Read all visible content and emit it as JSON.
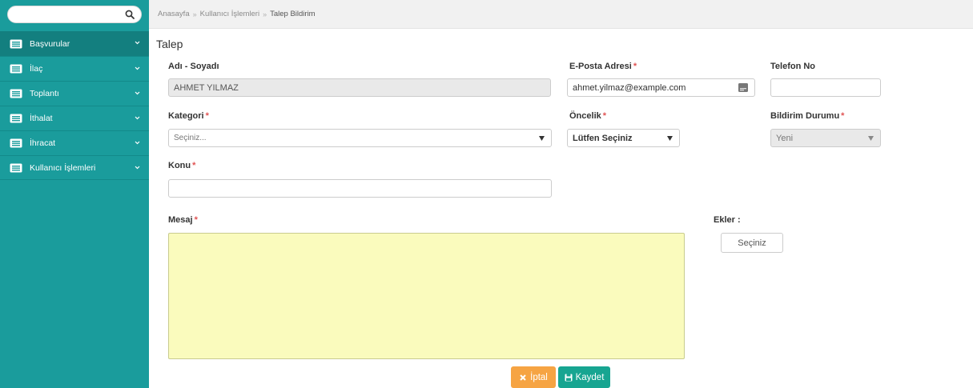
{
  "sidebar": {
    "search_placeholder": "",
    "items": [
      {
        "label": "Başvurular",
        "icon": "list-icon",
        "active": true
      },
      {
        "label": "İlaç",
        "icon": "list-icon"
      },
      {
        "label": "Toplantı",
        "icon": "list-icon"
      },
      {
        "label": "İthalat",
        "icon": "list-icon"
      },
      {
        "label": "İhracat",
        "icon": "list-icon"
      },
      {
        "label": "Kullanıcı İşlemleri",
        "icon": "list-icon"
      }
    ]
  },
  "breadcrumb": [
    "Anasayfa",
    "Kullanıcı İşlemleri",
    "Talep Bildirim"
  ],
  "page": {
    "title": "Talep"
  },
  "form": {
    "required_mark": "*",
    "name": {
      "label": "Adı - Soyadı",
      "value": "AHMET YILMAZ"
    },
    "email": {
      "label": "E-Posta Adresi",
      "value": "ahmet.yilmaz@example.com"
    },
    "phone": {
      "label": "Telefon No",
      "value": ""
    },
    "category": {
      "label": "Kategori",
      "value": "Seçiniz..."
    },
    "priority": {
      "label": "Öncelik",
      "value": "Lütfen Seçiniz"
    },
    "status": {
      "label": "Bildirim Durumu",
      "value": "Yeni"
    },
    "subject": {
      "label": "Konu",
      "value": ""
    },
    "message": {
      "label": "Mesaj",
      "value": ""
    },
    "attachments": {
      "label": "Ekler :",
      "button_label": "Seçiniz"
    }
  },
  "actions": {
    "cancel_label": "İptal",
    "save_label": "Kaydet"
  },
  "colors": {
    "sidebar_bg": "#1a9c9c",
    "sidebar_active": "#137f7f",
    "required": "#e05353",
    "message_bg": "#fafbbd",
    "cancel_button": "#f6a443",
    "save_button": "#17a591"
  }
}
